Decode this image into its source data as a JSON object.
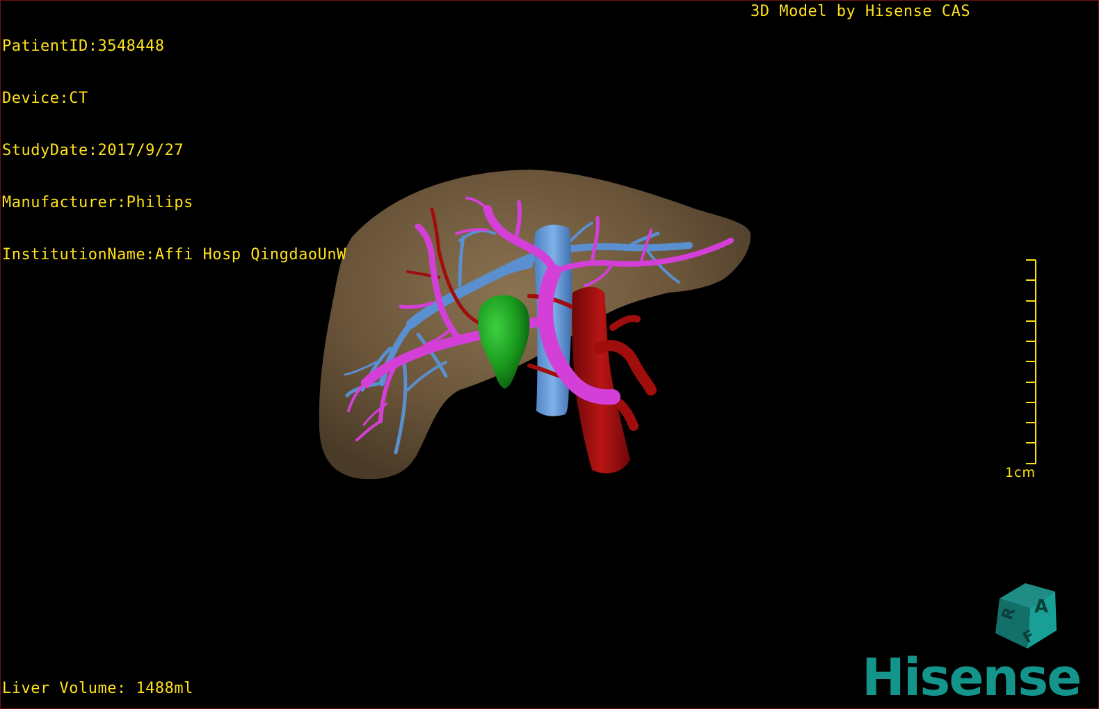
{
  "overlay": {
    "patient_id": "PatientID:3548448",
    "device": "Device:CT",
    "study_date": "StudyDate:2017/9/27",
    "manufacturer": "Manufacturer:Philips",
    "institution": "InstitutionName:Affi Hosp QingdaoUnW",
    "model_credit": "3D Model by Hisense CAS",
    "liver_volume": "Liver Volume: 1488ml"
  },
  "scalebar": {
    "label": "1cm"
  },
  "orientation_cube": {
    "face_a": "A",
    "face_r": "R",
    "face_f": "F"
  },
  "brand": {
    "name": "Hisense"
  },
  "colors": {
    "overlay_text": "#ffe21a",
    "liver": "#6f5a3e",
    "portal_vein": "#d43fd8",
    "hepatic_vein": "#5a8fd0",
    "artery": "#a00d0d",
    "gallbladder": "#1a9a1e",
    "brand": "#13958c",
    "viewport_border": "#6e1216"
  }
}
